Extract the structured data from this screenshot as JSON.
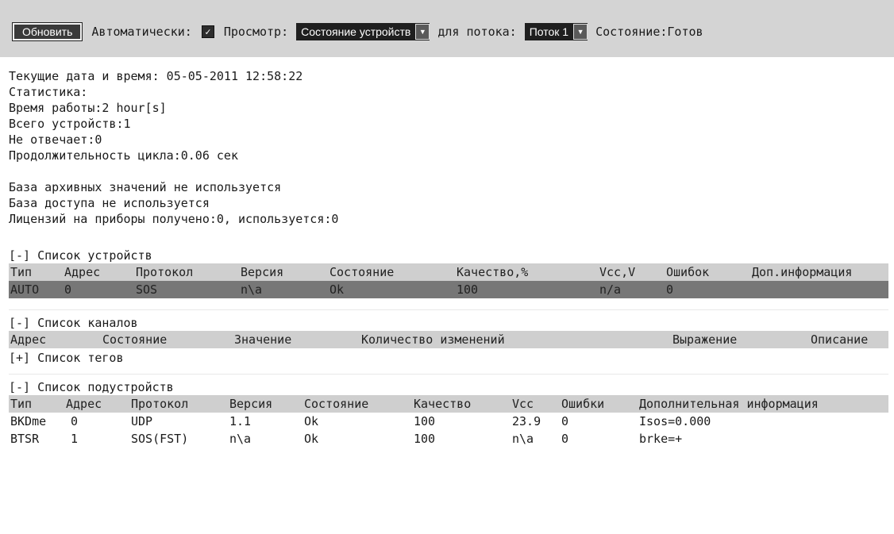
{
  "toolbar": {
    "refresh_label": "Обновить",
    "auto_label": "Автоматически:",
    "auto_checked": true,
    "view_label": "Просмотр:",
    "view_value": "Состояние устройств",
    "stream_label": "для потока:",
    "stream_value": "Поток 1",
    "state_label": "Состояние:Готов"
  },
  "status": {
    "datetime": "Текущие дата и время: 05-05-2011 12:58:22",
    "stats_title": "Статистика:",
    "uptime": "Время работы:2 hour[s]",
    "devices_total": "Всего устройств:1",
    "not_responding": "Не отвечает:0",
    "cycle": "Продолжительность цикла:0.06 сек",
    "archive_db": "База архивных значений не используется",
    "access_db": "База доступа не используется",
    "licenses": "Лицензий на приборы получено:0, используется:0"
  },
  "devices": {
    "toggle": "[-]",
    "title": "Список устройств",
    "headers": [
      "Тип",
      "Адрес",
      "Протокол",
      "Версия",
      "Состояние",
      "Качество,%",
      "Vcc,V",
      "Ошибок",
      "Доп.информация"
    ],
    "rows": [
      [
        "AUTO",
        "0",
        "SOS",
        "n\\a",
        "Ok",
        "100",
        "n/a",
        "0",
        ""
      ]
    ]
  },
  "channels": {
    "toggle": "[-]",
    "title": "Список каналов",
    "headers": [
      "Адрес",
      "Состояние",
      "Значение",
      "Количество изменений",
      "Выражение",
      "Описание"
    ]
  },
  "tags": {
    "toggle": "[+]",
    "title": "Список тегов"
  },
  "subdevices": {
    "toggle": "[-]",
    "title": "Список подустройств",
    "headers": [
      "Тип",
      "Адрес",
      "Протокол",
      "Версия",
      "Состояние",
      "Качество",
      "Vcc",
      "Ошибки",
      "Дополнительная информация"
    ],
    "rows": [
      [
        "BKDme",
        "0",
        "UDP",
        "1.1",
        "Ok",
        "100",
        "23.9",
        "0",
        "Isos=0.000"
      ],
      [
        "BTSR",
        "1",
        "SOS(FST)",
        "n\\a",
        "Ok",
        "100",
        "n\\a",
        "0",
        "brke=+"
      ]
    ]
  }
}
